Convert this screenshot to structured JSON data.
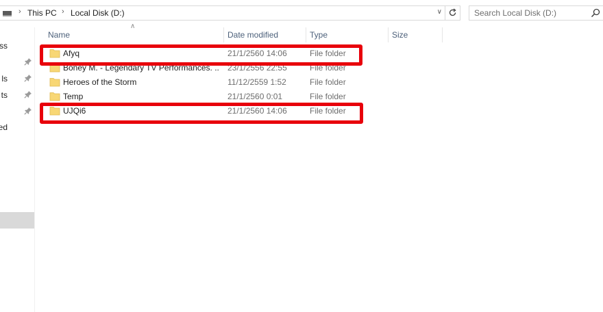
{
  "address_bar": {
    "crumbs": [
      "This PC",
      "Local Disk (D:)"
    ],
    "search_placeholder": "Search Local Disk (D:)"
  },
  "nav_pane": {
    "items": [
      {
        "label": "ss",
        "pinned": false
      },
      {
        "label": "",
        "pinned": true
      },
      {
        "label": "ls",
        "pinned": true
      },
      {
        "label": "ts",
        "pinned": true
      },
      {
        "label": "",
        "pinned": true
      },
      {
        "label": "ed",
        "pinned": false
      }
    ]
  },
  "columns": {
    "name": "Name",
    "date_modified": "Date modified",
    "type": "Type",
    "size": "Size"
  },
  "files": [
    {
      "name": "Afyq",
      "date_modified": "21/1/2560 14:06",
      "type": "File folder",
      "highlighted": true
    },
    {
      "name": "Boney M. - Legendary TV Performances. ...",
      "date_modified": "23/1/2556 22:55",
      "type": "File folder",
      "highlighted": false
    },
    {
      "name": "Heroes of the Storm",
      "date_modified": "11/12/2559 1:52",
      "type": "File folder",
      "highlighted": false
    },
    {
      "name": "Temp",
      "date_modified": "21/1/2560 0:01",
      "type": "File folder",
      "highlighted": false
    },
    {
      "name": "UJQi6",
      "date_modified": "21/1/2560 14:06",
      "type": "File folder",
      "highlighted": true
    }
  ],
  "colors": {
    "folder": "#f8d775",
    "highlight": "#e8000b",
    "header_text": "#4c607a"
  }
}
